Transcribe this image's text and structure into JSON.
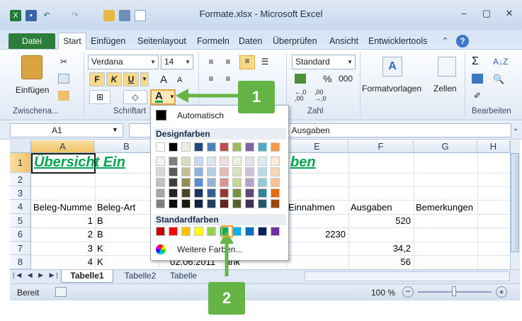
{
  "window": {
    "title": "Formate.xlsx - Microsoft Excel",
    "buttons": [
      "–",
      "▢",
      "✕"
    ]
  },
  "tabs": [
    "Datei",
    "Start",
    "Einfügen",
    "Seitenlayout",
    "Formeln",
    "Daten",
    "Überprüfen",
    "Ansicht",
    "Entwicklertools"
  ],
  "ribbon": {
    "clipboard": {
      "paste_label": "Einfügen",
      "group_label": "Zwischena..."
    },
    "font": {
      "font_name": "Verdana",
      "font_size": "14",
      "bold": "F",
      "italic": "K",
      "underline": "U",
      "grow": "A",
      "shrink": "A",
      "color_letter": "A",
      "group_label": "Schriftart"
    },
    "alignment": {
      "group_label": "Ausrichtung"
    },
    "number": {
      "format": "Standard",
      "percent": "%",
      "thousands": "000",
      "dec_more": ",0\n,00",
      "dec_less": ",00\n,0",
      "group_label": "Zahl"
    },
    "styles": {
      "label": "Formatvorlagen"
    },
    "cells": {
      "label": "Zellen"
    },
    "editing": {
      "sigma": "Σ",
      "sort": "A Z",
      "find": "A",
      "group_label": "Bearbeiten"
    }
  },
  "formula_bar": {
    "name_box": "A1",
    "fx": "fx",
    "content": "- Ausgaben"
  },
  "grid": {
    "columns": [
      "A",
      "B",
      "C",
      "D",
      "E",
      "F",
      "G",
      "H"
    ],
    "rows": [
      "1",
      "2",
      "3",
      "4",
      "5",
      "6",
      "7",
      "8"
    ],
    "heading": "Übersicht Ein",
    "heading_tail": "ben",
    "header_row": [
      "Beleg-Numme",
      "Beleg-Art",
      "Einnahmen",
      "Ausgaben",
      "Bemerkungen"
    ],
    "data": [
      {
        "a": "1",
        "b": "B",
        "e": "",
        "f": "520"
      },
      {
        "a": "2",
        "b": "B",
        "e": "2230",
        "f": ""
      },
      {
        "a": "3",
        "b": "K",
        "e": "",
        "f": "34,2"
      },
      {
        "a": "4",
        "b": "K",
        "d": "02.06.2011",
        "dtail": "ank",
        "e": "",
        "f": "56"
      }
    ]
  },
  "sheets": {
    "tabs": [
      "Tabelle1",
      "Tabelle2",
      "Tabelle"
    ],
    "active": "Tabelle1"
  },
  "status": {
    "mode": "Bereit",
    "zoom": "100 %"
  },
  "dropdown": {
    "automatic": "Automatisch",
    "design_title": "Designfarben",
    "standard_title": "Standardfarben",
    "more_colors": "Weitere Farben...",
    "theme_top": [
      "#ffffff",
      "#000000",
      "#eeece1",
      "#1f497d",
      "#4f81bd",
      "#c0504d",
      "#9bbb59",
      "#8064a2",
      "#4bacc6",
      "#f79646"
    ],
    "theme_shades": [
      [
        "#f2f2f2",
        "#7f7f7f",
        "#ddd9c3",
        "#c6d9f0",
        "#dbe5f1",
        "#f2dcdb",
        "#ebf1dd",
        "#e5e0ec",
        "#dbeef3",
        "#fdeada"
      ],
      [
        "#d8d8d8",
        "#595959",
        "#c4bd97",
        "#8db3e2",
        "#b8cce4",
        "#e5b9b7",
        "#d7e3bc",
        "#ccc1d9",
        "#b7dde8",
        "#fbd5b5"
      ],
      [
        "#bfbfbf",
        "#3f3f3f",
        "#938953",
        "#548dd4",
        "#95b3d7",
        "#d99694",
        "#c3d69b",
        "#b2a2c7",
        "#92cddc",
        "#fac08f"
      ],
      [
        "#a5a5a5",
        "#262626",
        "#494429",
        "#17365d",
        "#366092",
        "#953734",
        "#76923c",
        "#5f497a",
        "#31859b",
        "#e36c09"
      ],
      [
        "#7f7f7f",
        "#0c0c0c",
        "#1d1b10",
        "#0f243e",
        "#244061",
        "#632423",
        "#4f6128",
        "#3f3151",
        "#205867",
        "#974806"
      ]
    ],
    "standard": [
      "#c00000",
      "#ff0000",
      "#ffc000",
      "#ffff00",
      "#92d050",
      "#00b050",
      "#00b0f0",
      "#0070c0",
      "#002060",
      "#7030a0"
    ]
  },
  "callouts": [
    "1",
    "2"
  ],
  "colors": {
    "accent_green": "#64b446",
    "heading_green": "#00a651",
    "file_tab": "#2c7c3a"
  }
}
